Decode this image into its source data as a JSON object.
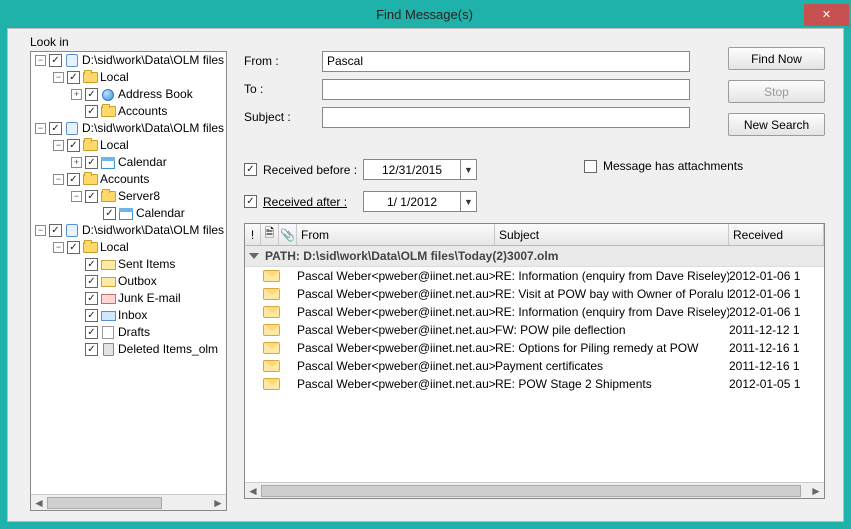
{
  "window": {
    "title": "Find Message(s)",
    "close": "✕",
    "lookin_label": "Look in"
  },
  "tree": [
    {
      "indent": 0,
      "tg": "−",
      "icon": "db",
      "label": "D:\\sid\\work\\Data\\OLM files"
    },
    {
      "indent": 1,
      "tg": "−",
      "icon": "fld",
      "label": "Local"
    },
    {
      "indent": 2,
      "tg": "+",
      "icon": "globe",
      "label": "Address Book"
    },
    {
      "indent": 2,
      "tg": "",
      "icon": "fld",
      "label": "Accounts"
    },
    {
      "indent": 0,
      "tg": "−",
      "icon": "db",
      "label": "D:\\sid\\work\\Data\\OLM files"
    },
    {
      "indent": 1,
      "tg": "−",
      "icon": "fld",
      "label": "Local"
    },
    {
      "indent": 2,
      "tg": "+",
      "icon": "cal",
      "label": "Calendar"
    },
    {
      "indent": 1,
      "tg": "−",
      "icon": "fld",
      "label": "Accounts"
    },
    {
      "indent": 2,
      "tg": "−",
      "icon": "fld",
      "label": "Server8"
    },
    {
      "indent": 3,
      "tg": "",
      "icon": "cal",
      "label": "Calendar"
    },
    {
      "indent": 0,
      "tg": "−",
      "icon": "db",
      "label": "D:\\sid\\work\\Data\\OLM files"
    },
    {
      "indent": 1,
      "tg": "−",
      "icon": "fld",
      "label": "Local"
    },
    {
      "indent": 2,
      "tg": "",
      "icon": "mail-out",
      "label": "Sent Items"
    },
    {
      "indent": 2,
      "tg": "",
      "icon": "mail-out",
      "label": "Outbox"
    },
    {
      "indent": 2,
      "tg": "",
      "icon": "mail-junk",
      "label": "Junk E-mail"
    },
    {
      "indent": 2,
      "tg": "",
      "icon": "mail-in",
      "label": "Inbox"
    },
    {
      "indent": 2,
      "tg": "",
      "icon": "draft",
      "label": "Drafts"
    },
    {
      "indent": 2,
      "tg": "",
      "icon": "trash",
      "label": "Deleted Items_olm"
    }
  ],
  "form": {
    "from_label": "From :",
    "to_label": "To :",
    "subject_label": "Subject :",
    "from_value": "Pascal",
    "to_value": "",
    "subject_value": "",
    "received_before_label": "Received before :",
    "received_before_value": "12/31/2015",
    "received_after_label": "Received after :",
    "received_after_value": "1/ 1/2012",
    "attach_label": "Message has attachments"
  },
  "buttons": {
    "find": "Find Now",
    "stop": "Stop",
    "newsearch": "New Search"
  },
  "columns": {
    "ex": "!",
    "doc": "🗎",
    "att": "📎",
    "from": "From",
    "subject": "Subject",
    "received": "Received"
  },
  "group_header": "PATH: D:\\sid\\work\\Data\\OLM files\\Today(2)3007.olm",
  "messages": [
    {
      "from": "Pascal Weber<pweber@iinet.net.au>",
      "subject": "RE: Information (enquiry from Dave Riseley)",
      "received": "2012-01-06 1"
    },
    {
      "from": "Pascal Weber<pweber@iinet.net.au>",
      "subject": "RE: Visit at POW bay with Owner of Poralu Marine",
      "received": "2012-01-06 1"
    },
    {
      "from": "Pascal Weber<pweber@iinet.net.au>",
      "subject": "RE: Information (enquiry from Dave Riseley)",
      "received": "2012-01-06 1"
    },
    {
      "from": "Pascal Weber<pweber@iinet.net.au>",
      "subject": "FW: POW pile deflection",
      "received": "2011-12-12 1"
    },
    {
      "from": "Pascal Weber<pweber@iinet.net.au>",
      "subject": "RE: Options for Piling remedy at POW",
      "received": "2011-12-16 1"
    },
    {
      "from": "Pascal Weber<pweber@iinet.net.au>",
      "subject": "Payment certificates",
      "received": "2011-12-16 1"
    },
    {
      "from": "Pascal Weber<pweber@iinet.net.au>",
      "subject": "RE: POW Stage 2 Shipments",
      "received": "2012-01-05 1"
    }
  ]
}
